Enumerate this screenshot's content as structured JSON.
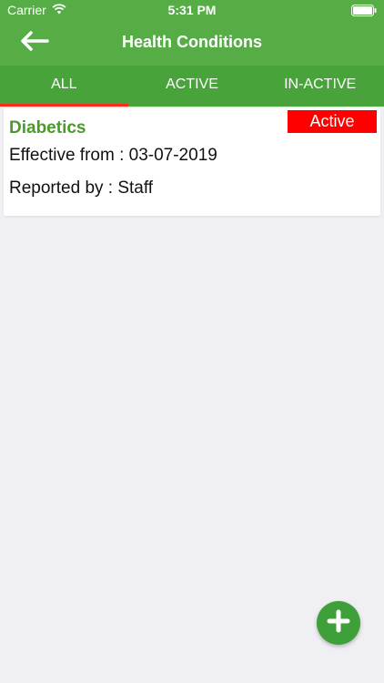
{
  "status_bar": {
    "carrier": "Carrier",
    "time": "5:31 PM"
  },
  "nav": {
    "title": "Health Conditions",
    "back_icon": "arrow-left-icon"
  },
  "tabs": [
    {
      "label": "ALL",
      "selected": true
    },
    {
      "label": "ACTIVE",
      "selected": false
    },
    {
      "label": "IN-ACTIVE",
      "selected": false
    }
  ],
  "conditions": [
    {
      "name": "Diabetics",
      "status": "Active",
      "effective_from": "Effective from : 03-07-2019",
      "reported_by": "Reported by : Staff"
    }
  ],
  "fab": {
    "icon": "plus-icon"
  },
  "colors": {
    "header_green": "#56ad46",
    "tab_green": "#48a33a",
    "tab_indicator": "#ff2a1a",
    "title_green": "#4c9a2a",
    "badge_red": "#ff0000",
    "background": "#efeff4"
  }
}
